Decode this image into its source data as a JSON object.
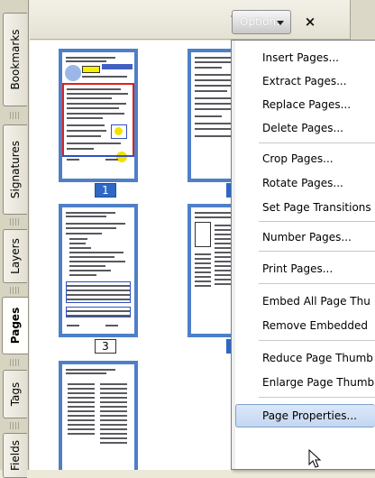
{
  "tabs": [
    {
      "label": "Bookmarks",
      "active": false
    },
    {
      "label": "Signatures",
      "active": false
    },
    {
      "label": "Layers",
      "active": false
    },
    {
      "label": "Pages",
      "active": true
    },
    {
      "label": "Tags",
      "active": false
    },
    {
      "label": "Fields",
      "active": false
    }
  ],
  "toolbar": {
    "trash_icon": "trash-icon",
    "options_label": "Options",
    "close_label": "×"
  },
  "thumbnails": {
    "pages": [
      {
        "number": "1",
        "selected": true
      },
      {
        "number": "",
        "selected": false
      },
      {
        "number": "3",
        "selected": false
      },
      {
        "number": "",
        "selected": false
      },
      {
        "number": "",
        "selected": false
      }
    ]
  },
  "menu": {
    "items": [
      {
        "label": "Insert Pages...",
        "group": 1
      },
      {
        "label": "Extract Pages...",
        "group": 1
      },
      {
        "label": "Replace Pages...",
        "group": 1
      },
      {
        "label": "Delete Pages...",
        "group": 1
      },
      {
        "label": "Crop Pages...",
        "group": 2
      },
      {
        "label": "Rotate Pages...",
        "group": 2
      },
      {
        "label": "Set Page Transitions",
        "group": 2
      },
      {
        "label": "Number Pages...",
        "group": 3
      },
      {
        "label": "Print Pages...",
        "group": 4
      },
      {
        "label": "Embed All Page Thu",
        "group": 5
      },
      {
        "label": "Remove Embedded",
        "group": 5
      },
      {
        "label": "Reduce Page Thumb",
        "group": 6
      },
      {
        "label": "Enlarge Page Thumb",
        "group": 6
      },
      {
        "label": "Page Properties...",
        "group": 7,
        "highlighted": true
      }
    ]
  },
  "colors": {
    "selection_blue": "#2f68c4",
    "thumb_border": "#4f7fc7",
    "menu_highlight": "#c3d6f1"
  }
}
